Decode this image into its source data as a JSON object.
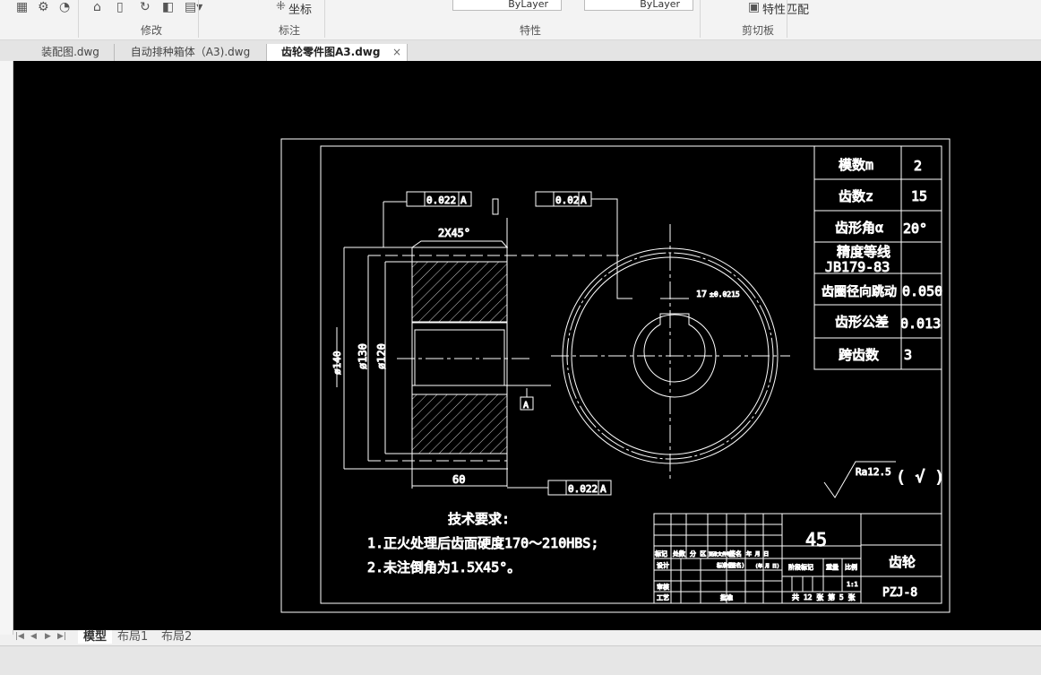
{
  "ribbon": {
    "groups": {
      "modify": "修改",
      "annotation": "标注",
      "properties": "特性",
      "clipboard": "剪切板"
    },
    "coordinate_label": "坐标",
    "match_properties_label": "特性匹配",
    "linetype_value": "ByLayer",
    "lineweight_value": "ByLayer",
    "icons": [
      "hatch-icon",
      "array-icon",
      "block-icon",
      "stretch-icon",
      "scale-icon",
      "rotate-icon",
      "3d-icon",
      "edit-icon",
      "paste-icon",
      "match-properties-icon"
    ]
  },
  "doc_tabs": [
    {
      "label": "装配图.dwg",
      "active": false
    },
    {
      "label": "自动排种箱体（A3).dwg",
      "active": false
    },
    {
      "label": "齿轮零件图A3.dwg",
      "active": true
    }
  ],
  "layout_tabs": [
    "模型",
    "布局1",
    "布局2"
  ],
  "drawing": {
    "tolerances": {
      "runout_top": "0.022",
      "flatness": "0.02",
      "runout_bottom": "0.022",
      "datum": "A"
    },
    "dims": {
      "chamfer": "2X45°",
      "width": "60",
      "d130": "ø130",
      "d120": "ø120",
      "d140": "ø140",
      "keyway": "17",
      "keyway_tol": "±0.0215"
    },
    "roughness": "Ra12.5",
    "roughness_rest": "( √ )",
    "params": [
      {
        "label": "模数m",
        "value": "2"
      },
      {
        "label": "齿数z",
        "value": "15"
      },
      {
        "label": "齿形角α",
        "value": "20°"
      },
      {
        "label": "精度等线",
        "label2": "JB179-83",
        "value": ""
      },
      {
        "label": "齿圈径向跳动",
        "value": "0.050"
      },
      {
        "label": "齿形公差",
        "value": "0.013"
      },
      {
        "label": "跨齿数",
        "value": "3"
      }
    ],
    "tech_title": "技术要求:",
    "tech_items": [
      "1.正火处理后齿面硬度170～210HBS;",
      "2.未注倒角为1.5X45°。"
    ],
    "title_block": {
      "material": "45",
      "part_name": "齿轮",
      "drawing_no": "PZJ-8",
      "row_headers": [
        "标记",
        "处数",
        "分 区",
        "更改文件号",
        "签名",
        "年 月 日"
      ],
      "design": "设计",
      "standardize": "标准化",
      "sign": "(签名)",
      "date": "(年 月 日)",
      "review": "审核",
      "process": "工艺",
      "approve": "批准",
      "stage": "阶段标记",
      "weight": "重量",
      "scale_label": "比例",
      "scale": "1:1",
      "sheets": "共 12 张 第 5 张"
    }
  }
}
